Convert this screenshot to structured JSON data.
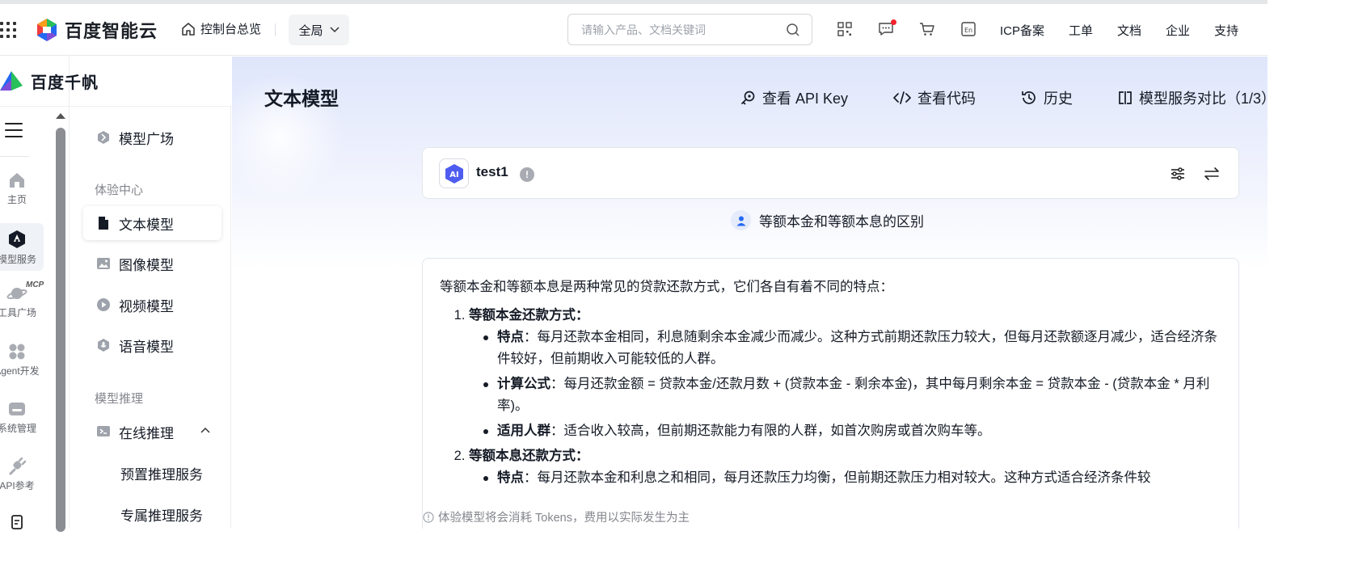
{
  "topbar": {
    "logo_text": "百度智能云",
    "console_link": "控制台总览",
    "scope_select": "全局",
    "search_placeholder": "请输入产品、文档关键词",
    "links": [
      "ICP备案",
      "工单",
      "文档",
      "企业",
      "支持"
    ]
  },
  "rail": {
    "brand": "百度千帆",
    "mcp_badge": "MCP",
    "items": [
      {
        "label": "主页"
      },
      {
        "label": "模型服务"
      },
      {
        "label": "工具广场"
      },
      {
        "label": "Agent开发"
      },
      {
        "label": "系统管理"
      },
      {
        "label": "API参考"
      }
    ]
  },
  "sidebar": {
    "model_square": "模型广场",
    "group_experience": "体验中心",
    "text_model": "文本模型",
    "image_model": "图像模型",
    "video_model": "视频模型",
    "voice_model": "语音模型",
    "group_inference": "模型推理",
    "online_inference": "在线推理",
    "preset_service": "预置推理服务",
    "dedicated_service": "专属推理服务"
  },
  "main": {
    "title": "文本模型",
    "actions": {
      "api_key": "查看 API Key",
      "code": "查看代码",
      "history": "历史",
      "compare": "模型服务对比（1/3）"
    },
    "model": {
      "avatar": "AI",
      "name": "test1",
      "info": "!"
    },
    "question": "等额本金和等额本息的区别",
    "answer": {
      "intro": "等额本金和等额本息是两种常见的贷款还款方式，它们各自有着不同的特点：",
      "sections": [
        {
          "title": "等额本金还款方式：",
          "points": [
            {
              "label": "特点",
              "text": "：每月还款本金相同，利息随剩余本金减少而减少。这种方式前期还款压力较大，但每月还款额逐月减少，适合经济条件较好，但前期收入可能较低的人群。"
            },
            {
              "label": "计算公式",
              "text": "：每月还款金额 = 贷款本金/还款月数 + (贷款本金 - 剩余本金)，其中每月剩余本金 = 贷款本金 - (贷款本金 * 月利率)。"
            },
            {
              "label": "适用人群",
              "text": "：适合收入较高，但前期还款能力有限的人群，如首次购房或首次购车等。"
            }
          ]
        },
        {
          "title": "等额本息还款方式：",
          "points": [
            {
              "label": "特点",
              "text": "：每月还款本金和利息之和相同，每月还款压力均衡，但前期还款压力相对较大。这种方式适合经济条件较"
            }
          ]
        }
      ]
    },
    "footer_note": "体验模型将会消耗 Tokens，费用以实际发生为主"
  },
  "colors": {
    "brand_blue": "#2468f2",
    "logo_green": "#27c05a",
    "logo_purple": "#7e4dd8",
    "red_dot": "#f5222d",
    "active_bg": "#eff2f6"
  }
}
